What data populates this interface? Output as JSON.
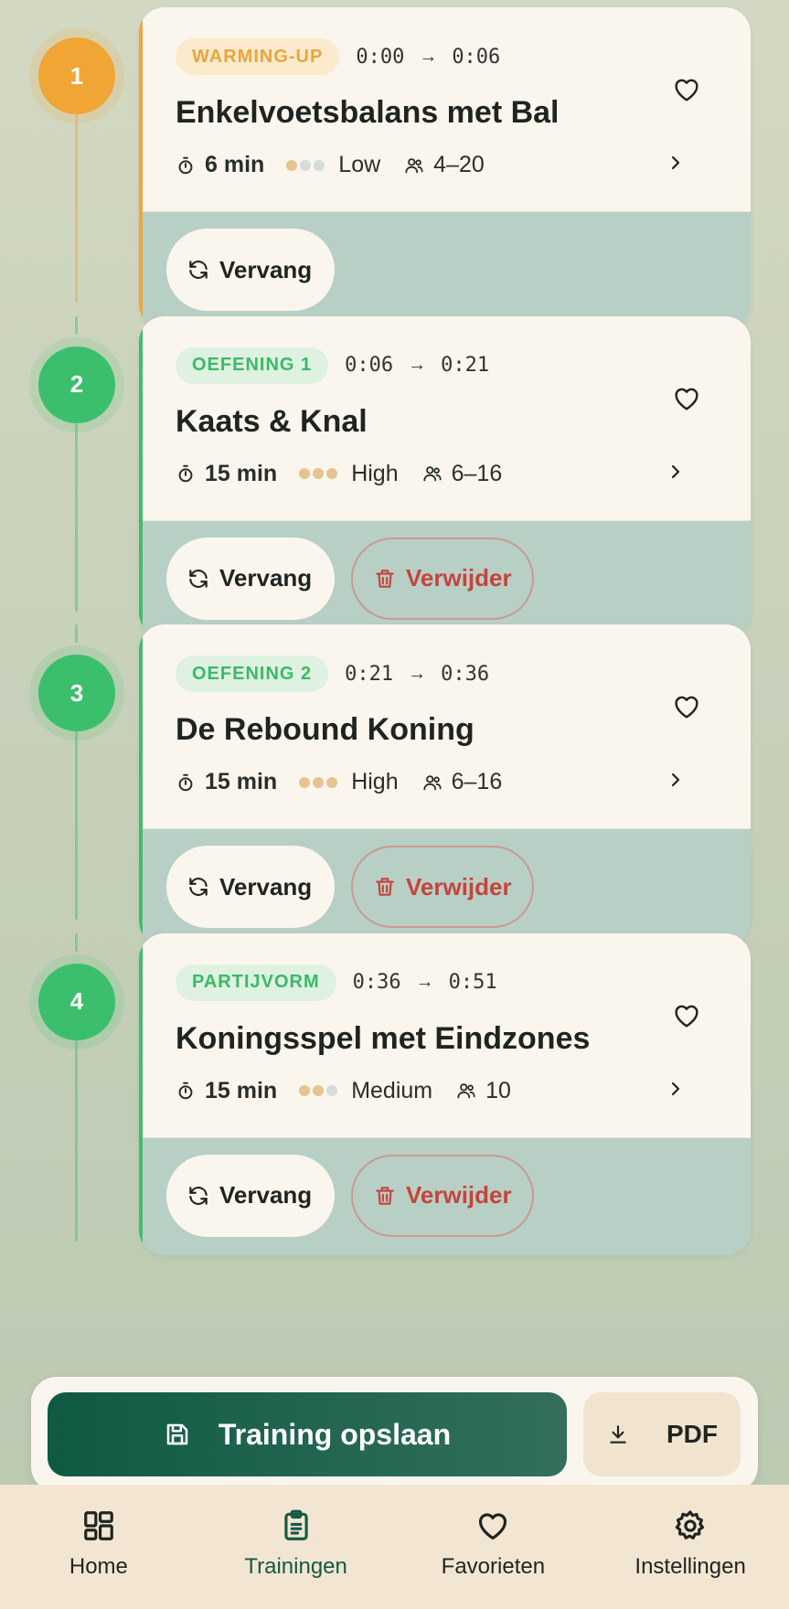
{
  "sessions": [
    {
      "step": "1",
      "color": "orange",
      "badge": "WARMING-UP",
      "start": "0:00",
      "arrow": "→",
      "end": "0:06",
      "title": "Enkelvoetsbalans met Bal",
      "duration": "6 min",
      "intensity_level": 1,
      "intensity": "Low",
      "players": "4–20",
      "replace_label": "Vervang",
      "delete_label": null
    },
    {
      "step": "2",
      "color": "green",
      "badge": "OEFENING 1",
      "start": "0:06",
      "arrow": "→",
      "end": "0:21",
      "title": "Kaats & Knal",
      "duration": "15 min",
      "intensity_level": 3,
      "intensity": "High",
      "players": "6–16",
      "replace_label": "Vervang",
      "delete_label": "Verwijder"
    },
    {
      "step": "3",
      "color": "green",
      "badge": "OEFENING 2",
      "start": "0:21",
      "arrow": "→",
      "end": "0:36",
      "title": "De Rebound Koning",
      "duration": "15 min",
      "intensity_level": 3,
      "intensity": "High",
      "players": "6–16",
      "replace_label": "Vervang",
      "delete_label": "Verwijder"
    },
    {
      "step": "4",
      "color": "green",
      "badge": "PARTIJVORM",
      "start": "0:36",
      "arrow": "→",
      "end": "0:51",
      "title": "Koningsspel met Eindzones",
      "duration": "15 min",
      "intensity_level": 2,
      "intensity": "Medium",
      "players": "10",
      "replace_label": "Vervang",
      "delete_label": "Verwijder"
    }
  ],
  "actions": {
    "save_label": "Training opslaan",
    "pdf_label": "PDF"
  },
  "nav": [
    {
      "label": "Home",
      "icon": "grid-icon",
      "active": false
    },
    {
      "label": "Trainingen",
      "icon": "clipboard-icon",
      "active": true
    },
    {
      "label": "Favorieten",
      "icon": "heart-icon",
      "active": false
    },
    {
      "label": "Instellingen",
      "icon": "gear-icon",
      "active": false
    }
  ],
  "colors": {
    "orange": "#f0a535",
    "green": "#3cbf6c",
    "primary": "#135a44",
    "delete": "#c5443c"
  }
}
